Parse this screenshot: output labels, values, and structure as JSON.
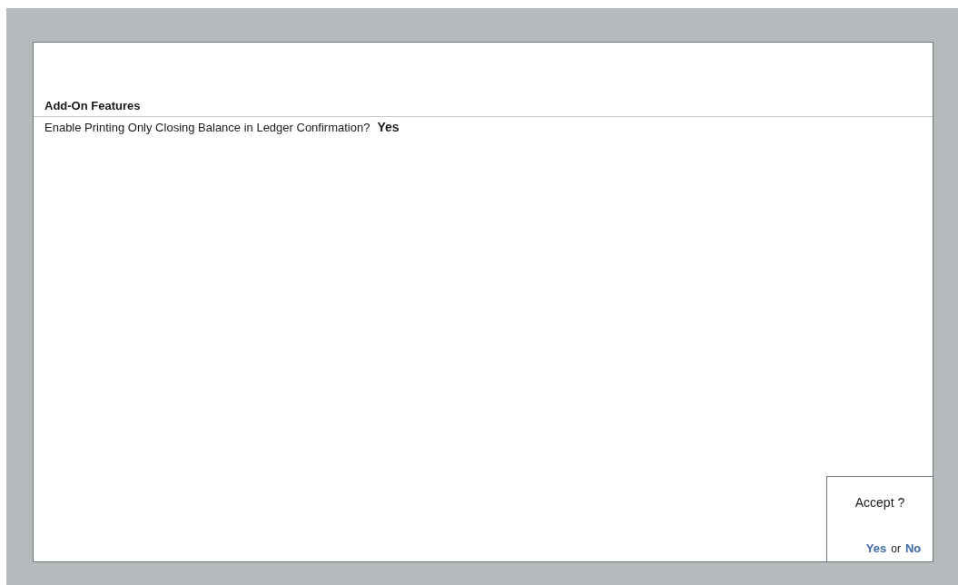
{
  "section": {
    "title": "Add-On Features",
    "fields": [
      {
        "label": "Enable Printing Only Closing Balance in Ledger Confirmation?",
        "value": "Yes"
      }
    ]
  },
  "dialog": {
    "question": "Accept ?",
    "yes": "Yes",
    "separator": "or",
    "no": "No"
  }
}
